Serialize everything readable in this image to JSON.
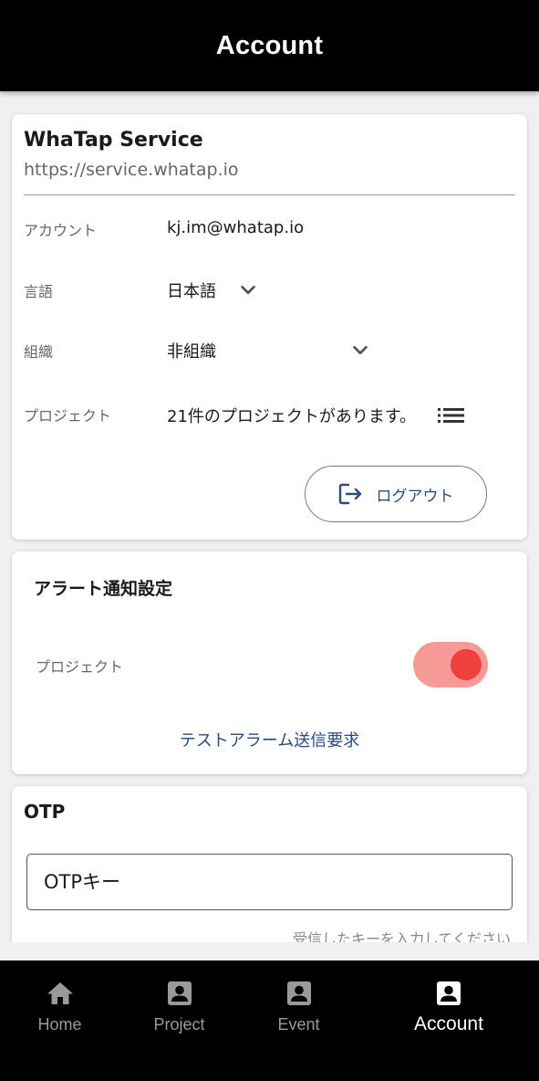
{
  "header": {
    "title": "Account"
  },
  "account_card": {
    "service_name": "WhaTap Service",
    "service_url": "https://service.whatap.io",
    "account_label": "アカウント",
    "account_value": "kj.im@whatap.io",
    "language_label": "言語",
    "language_value": "日本語",
    "org_label": "組織",
    "org_value": "非組織",
    "project_label": "プロジェクト",
    "project_value": "21件のプロジェクトがあります。",
    "logout_label": "ログアウト"
  },
  "alert_card": {
    "title": "アラート通知設定",
    "project_label": "プロジェクト",
    "project_toggle_on": true,
    "test_link": "テストアラーム送信要求"
  },
  "otp_card": {
    "title": "OTP",
    "input_placeholder": "OTPキー",
    "hint": "受信したキーを入力してください"
  },
  "bottom_nav": {
    "items": [
      {
        "label": "Home",
        "icon": "home-icon",
        "active": false
      },
      {
        "label": "Project",
        "icon": "account-box-icon",
        "active": false
      },
      {
        "label": "Event",
        "icon": "account-box-icon",
        "active": false
      },
      {
        "label": "Account",
        "icon": "account-box-icon",
        "active": true
      }
    ]
  },
  "colors": {
    "app_bar": "#000000",
    "link": "#2b4a7e",
    "toggle_track": "#f69a96",
    "toggle_knob": "#f0403b"
  }
}
